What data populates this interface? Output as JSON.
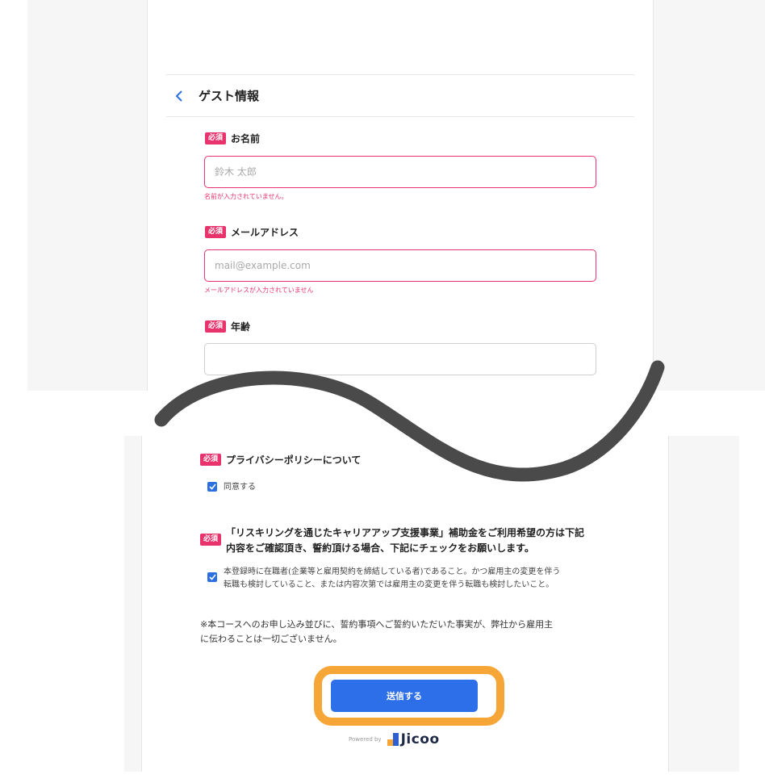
{
  "top": {
    "cut_text": "",
    "section_title": "ゲスト情報",
    "required_label": "必須",
    "fields": [
      {
        "label": "お名前",
        "placeholder": "鈴木 太郎",
        "value": "",
        "error": "名前が入力されていません。"
      },
      {
        "label": "メールアドレス",
        "placeholder": "mail@example.com",
        "value": "",
        "error": "メールアドレスが入力されていません"
      },
      {
        "label": "年齢",
        "placeholder": "",
        "value": "",
        "error": ""
      }
    ]
  },
  "bottom": {
    "required_label": "必須",
    "privacy_title": "プライバシーポリシーについて",
    "privacy_checkbox": "同意する",
    "reskilling_title_line1": "「リスキリングを通じたキャリアアップ支援事業」補助金をご利用希望の方は下記",
    "reskilling_title_line2": "内容をご確認頂き、誓約頂ける場合、下記にチェックをお願いします。",
    "reskilling_check_line1": "本登録時に在職者(企業等と雇用契約を締結している者)であること。かつ雇用主の変更を伴う",
    "reskilling_check_line2": "転職も検討していること、または内容次第では雇用主の変更を伴う転職も検討したいこと。",
    "note_line1": "※本コースへのお申し込み並びに、誓約事項へご誓約いただいた事実が、弊社から雇用主",
    "note_line2": "に伝わることは一切ございません。",
    "submit_label": "送信する",
    "powered_by": "Powered by",
    "brand": "Jicoo"
  },
  "colors": {
    "required_badge": "#e8336d",
    "error": "#e8336d",
    "primary_button": "#2d6fe8",
    "highlight_ring": "#f5a637",
    "checkbox": "#2c6fe0",
    "wave": "#4a4a4a"
  },
  "icons": {
    "back": "chevron-left-icon",
    "checkbox": "checkmark-icon",
    "logo": "jicoo-logo-icon"
  }
}
